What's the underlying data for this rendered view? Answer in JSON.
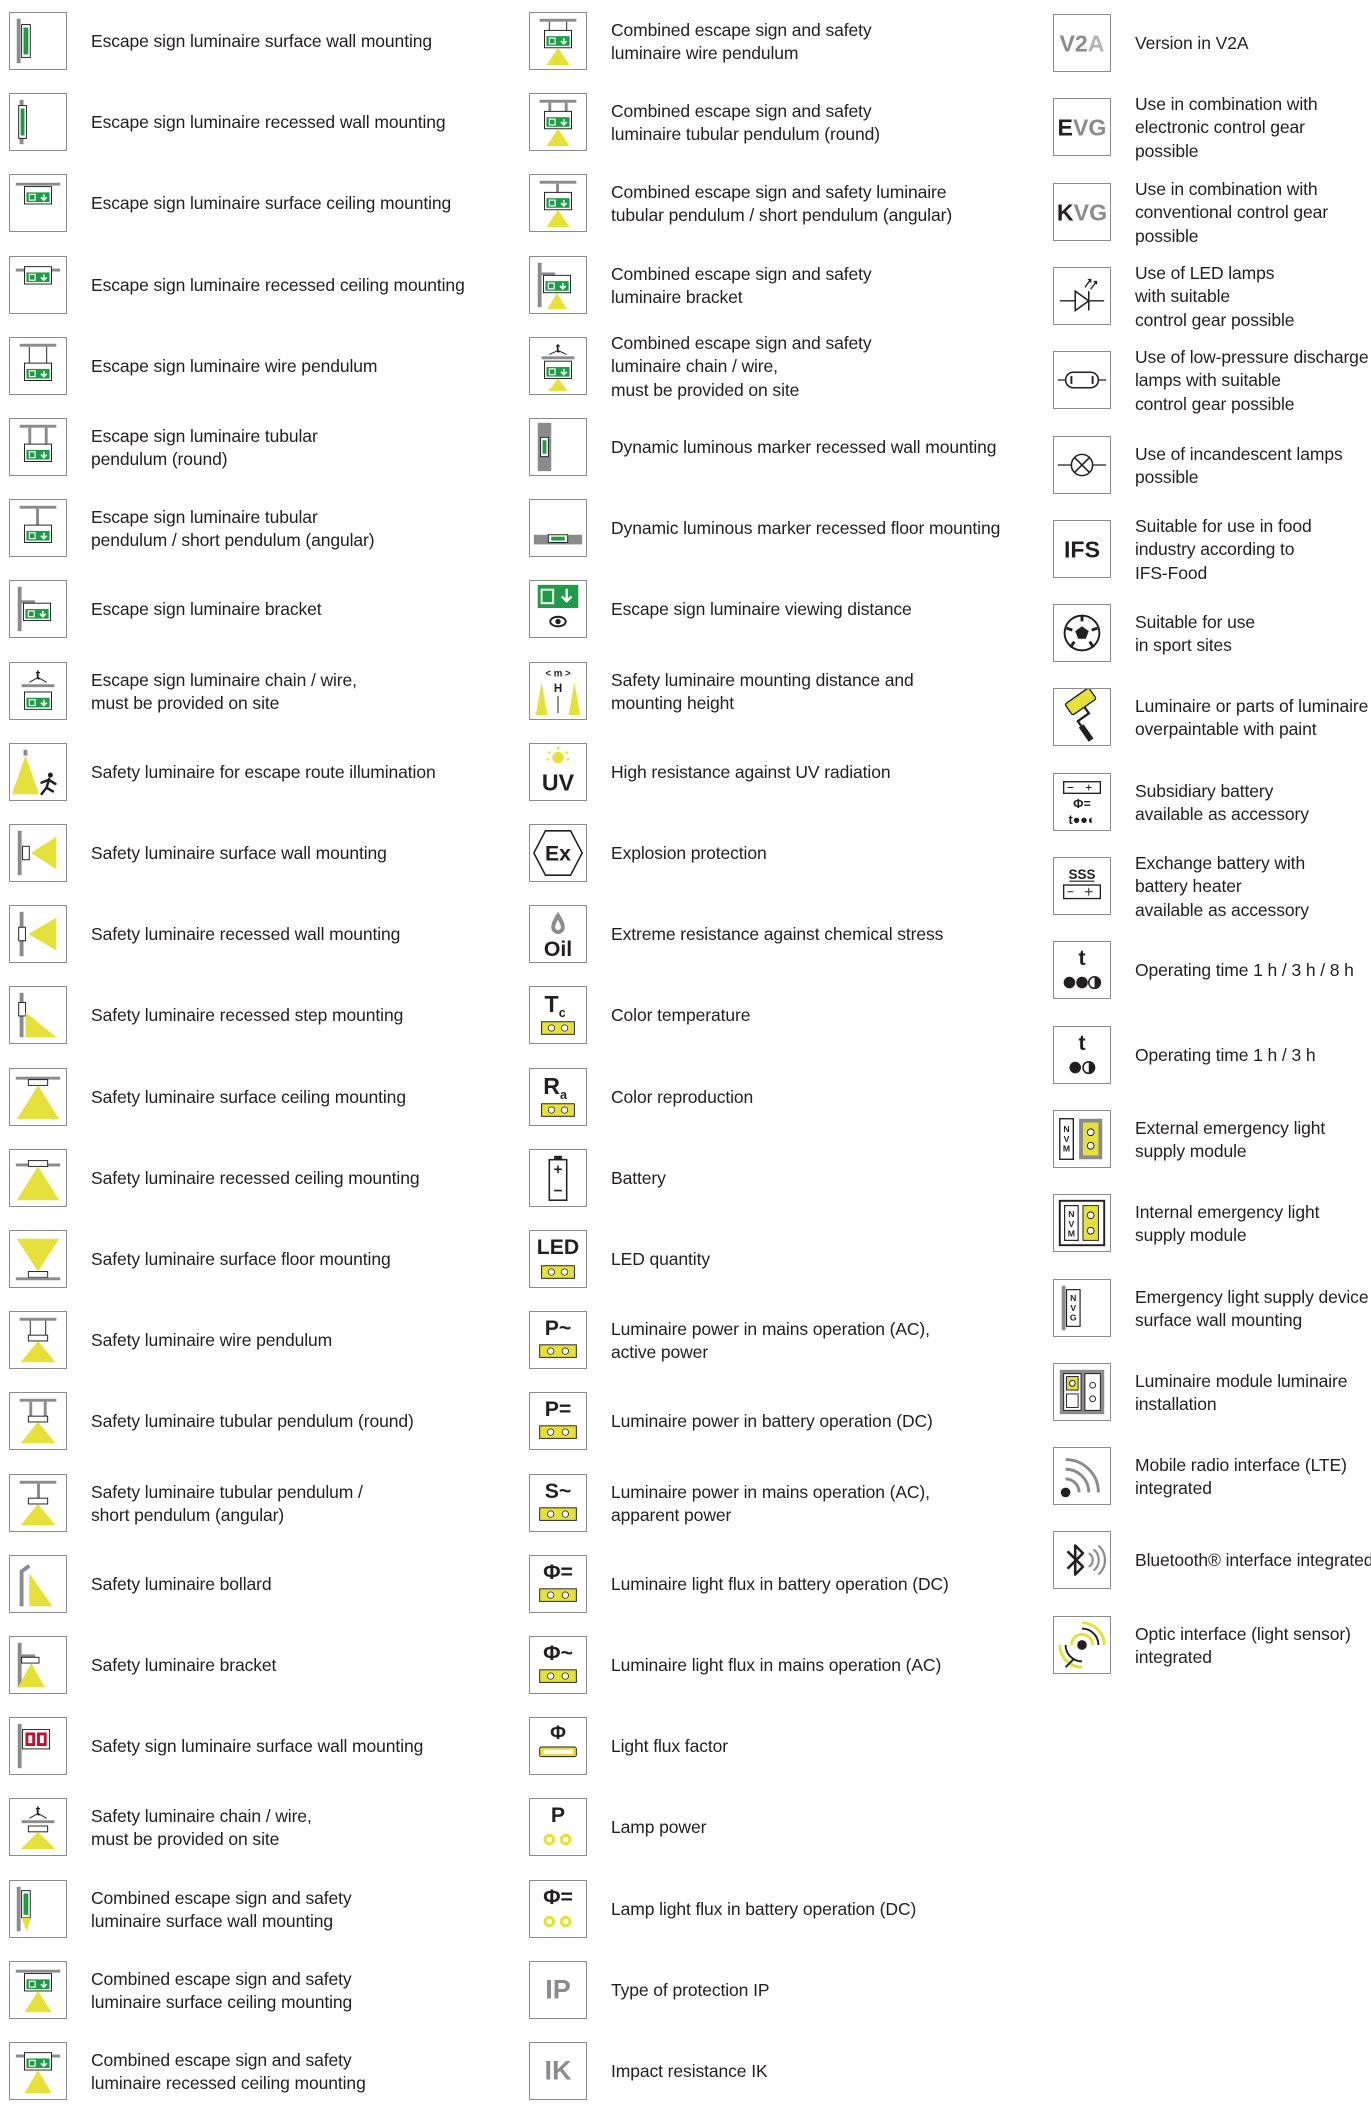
{
  "palette": {
    "green": "#1f9a47",
    "yellow": "#e6e03a",
    "grey": "#8a8b8d",
    "dark": "#231f20",
    "paper": "#ffffff"
  },
  "columns": [
    {
      "items": [
        {
          "icon": "escape-sign-wall-surface-icon",
          "text": "Escape sign luminaire surface wall mounting"
        },
        {
          "icon": "escape-sign-wall-recessed-icon",
          "text": "Escape sign luminaire recessed wall mounting"
        },
        {
          "icon": "escape-sign-ceiling-surface-icon",
          "text": "Escape sign luminaire surface ceiling mounting"
        },
        {
          "icon": "escape-sign-ceiling-recessed-icon",
          "text": "Escape sign luminaire recessed ceiling mounting"
        },
        {
          "icon": "escape-sign-wire-pendulum-icon",
          "text": "Escape sign luminaire wire pendulum"
        },
        {
          "icon": "escape-sign-tubular-round-icon",
          "text": "Escape sign luminaire tubular\npendulum (round)"
        },
        {
          "icon": "escape-sign-tubular-angular-icon",
          "text": "Escape sign luminaire tubular\npendulum / short pendulum (angular)"
        },
        {
          "icon": "escape-sign-bracket-icon",
          "text": "Escape sign luminaire bracket"
        },
        {
          "icon": "escape-sign-chain-wire-icon",
          "text": "Escape sign luminaire chain / wire,\nmust be provided on site"
        },
        {
          "icon": "escape-route-illumination-icon",
          "text": "Safety luminaire for escape route illumination"
        },
        {
          "icon": "safety-wall-surface-icon",
          "text": "Safety luminaire surface wall mounting"
        },
        {
          "icon": "safety-wall-recessed-icon",
          "text": "Safety luminaire recessed wall mounting"
        },
        {
          "icon": "safety-step-recessed-icon",
          "text": "Safety luminaire recessed step mounting"
        },
        {
          "icon": "safety-ceiling-surface-icon",
          "text": "Safety luminaire surface ceiling mounting"
        },
        {
          "icon": "safety-ceiling-recessed-icon",
          "text": "Safety luminaire recessed ceiling mounting"
        },
        {
          "icon": "safety-floor-surface-icon",
          "text": "Safety luminaire surface floor mounting"
        },
        {
          "icon": "safety-wire-pendulum-icon",
          "text": "Safety luminaire wire pendulum"
        },
        {
          "icon": "safety-tubular-round-icon",
          "text": "Safety luminaire tubular pendulum (round)"
        },
        {
          "icon": "safety-tubular-angular-icon",
          "text": "Safety luminaire tubular pendulum /\nshort pendulum (angular)"
        },
        {
          "icon": "safety-bollard-icon",
          "text": "Safety luminaire bollard"
        },
        {
          "icon": "safety-bracket-icon",
          "text": "Safety luminaire bracket"
        },
        {
          "icon": "safety-sign-wall-surface-icon",
          "text": "Safety sign luminaire surface wall mounting"
        },
        {
          "icon": "safety-chain-wire-icon",
          "text": "Safety luminaire chain / wire,\nmust be provided on site"
        },
        {
          "icon": "combined-wall-surface-icon",
          "text": "Combined escape sign and safety\nluminaire surface wall mounting"
        },
        {
          "icon": "combined-ceiling-surface-icon",
          "text": "Combined escape sign and safety\nluminaire surface ceiling mounting"
        },
        {
          "icon": "combined-ceiling-recessed-icon",
          "text": "Combined escape sign and safety\nluminaire recessed ceiling mounting"
        }
      ]
    },
    {
      "items": [
        {
          "icon": "combined-wire-pendulum-icon",
          "text": "Combined escape sign and safety\nluminaire wire pendulum"
        },
        {
          "icon": "combined-tubular-round-icon",
          "text": "Combined escape sign and safety\nluminaire tubular pendulum (round)"
        },
        {
          "icon": "combined-tubular-angular-icon",
          "text": "Combined escape sign and safety luminaire\ntubular pendulum / short pendulum (angular)"
        },
        {
          "icon": "combined-bracket-icon",
          "text": "Combined escape sign and safety\nluminaire bracket"
        },
        {
          "icon": "combined-chain-wire-icon",
          "text": "Combined escape sign and safety\nluminaire chain / wire,\nmust be provided on site"
        },
        {
          "icon": "marker-wall-recessed-icon",
          "text": "Dynamic luminous marker recessed wall mounting"
        },
        {
          "icon": "marker-floor-recessed-icon",
          "text": "Dynamic luminous marker recessed floor mounting"
        },
        {
          "icon": "viewing-distance-icon",
          "text": "Escape sign luminaire viewing distance"
        },
        {
          "icon": "mounting-distance-height-icon",
          "text": "Safety luminaire mounting distance and\nmounting height"
        },
        {
          "icon": "uv-resistance-icon",
          "text": "High resistance against UV radiation"
        },
        {
          "icon": "explosion-protection-icon",
          "text": "Explosion protection"
        },
        {
          "icon": "chemical-resistance-icon",
          "text": "Extreme resistance against chemical stress"
        },
        {
          "icon": "color-temperature-icon",
          "text": "Color temperature"
        },
        {
          "icon": "color-reproduction-icon",
          "text": "Color reproduction"
        },
        {
          "icon": "battery-icon",
          "text": "Battery"
        },
        {
          "icon": "led-quantity-icon",
          "text": "LED quantity"
        },
        {
          "icon": "power-mains-active-icon",
          "text": "Luminaire power in mains operation (AC),\nactive power"
        },
        {
          "icon": "power-battery-icon",
          "text": "Luminaire power in battery operation (DC)"
        },
        {
          "icon": "power-mains-apparent-icon",
          "text": "Luminaire power in mains operation (AC),\napparent power"
        },
        {
          "icon": "flux-battery-icon",
          "text": "Luminaire light flux in battery operation (DC)"
        },
        {
          "icon": "flux-mains-icon",
          "text": "Luminaire light flux in mains operation (AC)"
        },
        {
          "icon": "flux-factor-icon",
          "text": "Light flux factor"
        },
        {
          "icon": "lamp-power-icon",
          "text": "Lamp power"
        },
        {
          "icon": "lamp-flux-battery-icon",
          "text": "Lamp light flux in battery operation (DC)"
        },
        {
          "icon": "ip-protection-icon",
          "text": "Type of protection IP"
        },
        {
          "icon": "ik-impact-icon",
          "text": "Impact resistance IK"
        }
      ]
    },
    {
      "items": [
        {
          "icon": "v2a-icon",
          "text": "Version in V2A"
        },
        {
          "icon": "evg-icon",
          "text": "Use in combination with\nelectronic control gear\npossible"
        },
        {
          "icon": "kvg-icon",
          "text": "Use in combination with\nconventional control gear\npossible"
        },
        {
          "icon": "led-lamp-icon",
          "text": "Use of LED lamps\nwith suitable\ncontrol gear possible"
        },
        {
          "icon": "discharge-lamp-icon",
          "text": "Use of low-pressure discharge\nlamps with suitable\ncontrol gear possible"
        },
        {
          "icon": "incandescent-lamp-icon",
          "text": "Use of incandescent lamps\npossible"
        },
        {
          "icon": "ifs-food-icon",
          "text": "Suitable for use in food\nindustry according to\nIFS-Food"
        },
        {
          "icon": "sport-ball-icon",
          "text": "Suitable for use\nin sport sites"
        },
        {
          "icon": "paint-roller-icon",
          "text": "Luminaire or parts of luminaire\noverpaintable with paint"
        },
        {
          "icon": "subsidiary-battery-icon",
          "text": "Subsidiary battery\navailable as accessory"
        },
        {
          "icon": "battery-heater-icon",
          "text": "Exchange battery with\nbattery heater\navailable as accessory"
        },
        {
          "icon": "operating-time-3-icon",
          "text": "Operating time 1 h / 3 h / 8 h"
        },
        {
          "icon": "operating-time-2-icon",
          "text": "Operating time 1 h / 3 h"
        },
        {
          "icon": "external-module-icon",
          "text": "External emergency light\nsupply module"
        },
        {
          "icon": "internal-module-icon",
          "text": "Internal emergency light\nsupply module"
        },
        {
          "icon": "supply-device-wall-icon",
          "text": "Emergency light supply device\nsurface wall mounting"
        },
        {
          "icon": "module-installation-icon",
          "text": "Luminaire module luminaire\ninstallation"
        },
        {
          "icon": "lte-interface-icon",
          "text": "Mobile radio interface (LTE)\nintegrated"
        },
        {
          "icon": "bluetooth-icon",
          "text": "Bluetooth® interface integrated"
        },
        {
          "icon": "optic-interface-icon",
          "text": "Optic interface (light sensor)\nintegrated"
        }
      ]
    }
  ],
  "icon_text": {
    "v2a": [
      "V2",
      "A"
    ],
    "evg": [
      "E",
      "VG"
    ],
    "kvg": [
      "K",
      "VG"
    ],
    "ifs": "IFS",
    "uv": "UV",
    "ex": "Ex",
    "oil": "Oil",
    "tc": [
      "T",
      "c"
    ],
    "ra": [
      "R",
      "a"
    ],
    "led": "LED",
    "p_ac": "P~",
    "p_dc": "P=",
    "s_ac": "S~",
    "phi_dc": "Φ=",
    "phi_ac": "Φ~",
    "phi": "Φ",
    "p": "P",
    "ip": "IP",
    "ik": "IK",
    "t": "t",
    "m": "< m >",
    "h": "H",
    "nvm": "NVM",
    "nvg": "NVG",
    "sss": "SSS",
    "t_cells": "t"
  }
}
